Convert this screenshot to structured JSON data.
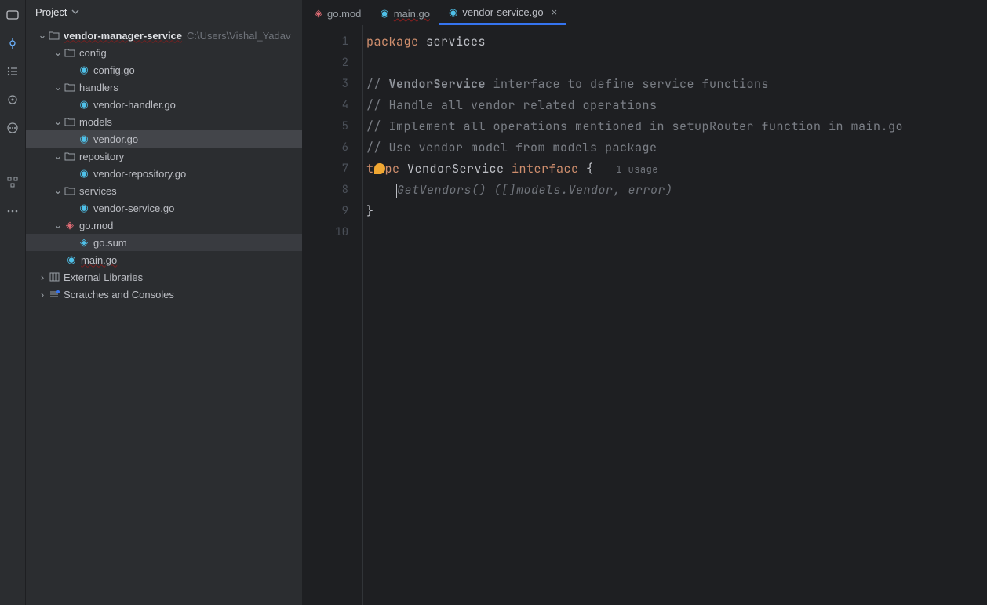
{
  "project": {
    "title": "Project"
  },
  "tree": {
    "root": {
      "name": "vendor-manager-service",
      "path": "C:\\Users\\Vishal_Yadav"
    },
    "config": {
      "name": "config",
      "file": "config.go"
    },
    "handlers": {
      "name": "handlers",
      "file": "vendor-handler.go"
    },
    "models": {
      "name": "models",
      "file": "vendor.go"
    },
    "repository": {
      "name": "repository",
      "file": "vendor-repository.go"
    },
    "services": {
      "name": "services",
      "file": "vendor-service.go"
    },
    "gomod": {
      "name": "go.mod",
      "sum": "go.sum"
    },
    "main": {
      "name": "main.go"
    },
    "extlib": {
      "name": "External Libraries"
    },
    "scratches": {
      "name": "Scratches and Consoles"
    }
  },
  "tabs": {
    "gomod": "go.mod",
    "main": "main.go",
    "service": "vendor-service.go"
  },
  "code": {
    "l1a": "package",
    "l1b": " services",
    "l3a": "// ",
    "l3b": "VendorService",
    "l3c": " interface to define service functions",
    "l4": "// Handle all vendor related operations",
    "l5": "// Implement all operations mentioned in setupRouter function in main.go",
    "l6": "// Use vendor model from models package",
    "l7a": "t",
    "l7b": "pe ",
    "l7c": "VendorService ",
    "l7d": "interface",
    "l7e": " {",
    "l7usage": "1 usage",
    "l8": "GetVendors() ([]models.Vendor, error)",
    "l9": "}"
  },
  "gutter": [
    "1",
    "2",
    "3",
    "4",
    "5",
    "6",
    "7",
    "8",
    "9",
    "10"
  ]
}
